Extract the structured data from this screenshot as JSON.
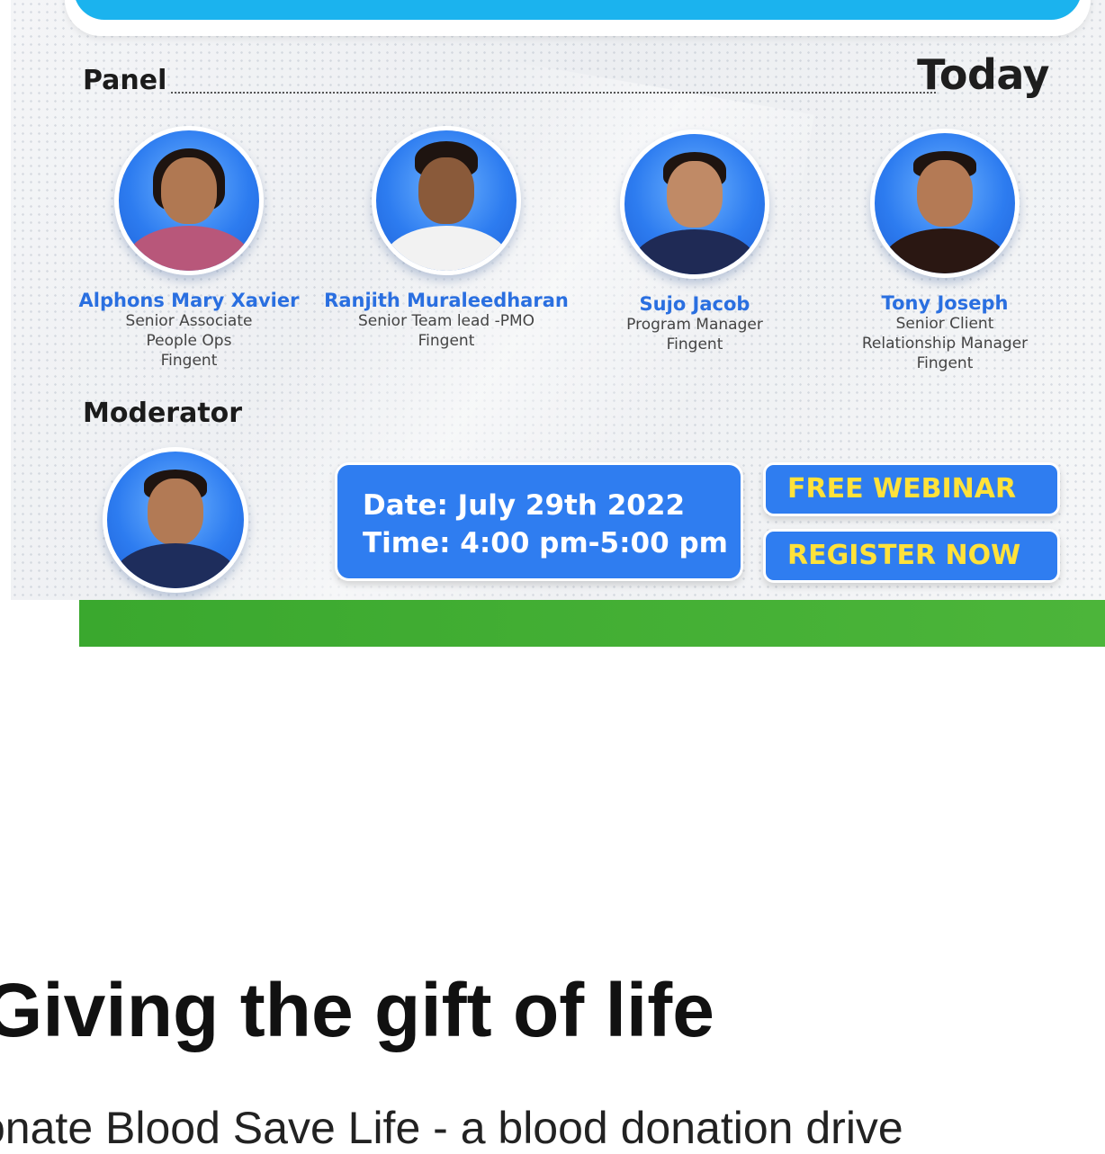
{
  "banner": {
    "panel_heading": "Panel",
    "today_label": "Today",
    "panelists": [
      {
        "name": "Alphons Mary Xavier",
        "role": "Senior Associate\nPeople Ops\nFingent"
      },
      {
        "name": "Ranjith Muraleedharan",
        "role": "Senior Team lead -PMO\nFingent"
      },
      {
        "name": "Sujo Jacob",
        "role": "Program Manager\nFingent"
      },
      {
        "name": "Tony Joseph",
        "role": "Senior Client\nRelationship Manager\nFingent"
      }
    ],
    "moderator_heading": "Moderator",
    "date_text": "Date: July 29th 2022",
    "time_text": "Time: 4:00 pm-5:00 pm",
    "cta_free": "FREE WEBINAR",
    "cta_register": "REGISTER NOW",
    "colors": {
      "accent_blue": "#2f7df0",
      "cta_text": "#ffe23a",
      "green_bar": "#3aa82e",
      "top_blue": "#1bb3ee"
    }
  },
  "article": {
    "title": "Giving the gift of life",
    "lead": "onate Blood Save Life - a blood donation drive"
  }
}
